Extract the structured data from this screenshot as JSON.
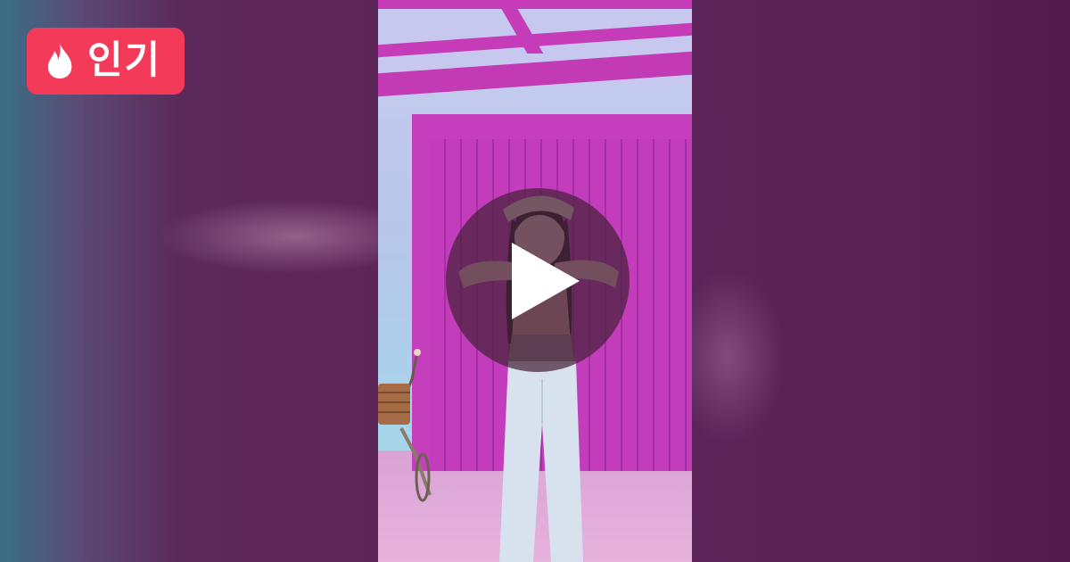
{
  "badge": {
    "label": "인기",
    "icon": "fire-icon",
    "color": "#f43a59"
  },
  "video": {
    "play_icon": "play-icon"
  },
  "colors": {
    "wall_pink": "#c53fbd",
    "background_purple": "#561c4c"
  }
}
